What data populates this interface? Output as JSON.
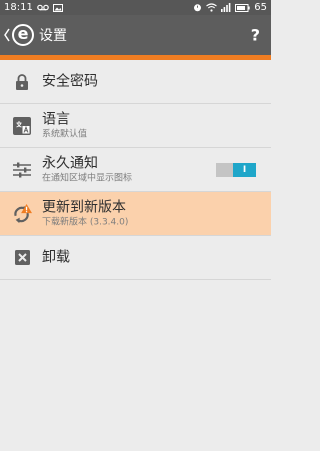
{
  "status_bar": {
    "time": "18:11",
    "battery": "65"
  },
  "app_bar": {
    "title": "设置",
    "help_label": "?",
    "logo_letter": "e"
  },
  "settings": [
    {
      "label": "安全密码",
      "sub": "",
      "icon": "lock-icon"
    },
    {
      "label": "语言",
      "sub": "系统默认值",
      "icon": "language-icon"
    },
    {
      "label": "永久通知",
      "sub": "在通知区域中显示图标",
      "icon": "sliders-icon",
      "toggle": "I",
      "toggle_on": true
    },
    {
      "label": "更新到新版本",
      "sub": "下载新版本 (3.3.4.0)",
      "icon": "update-warning-icon"
    },
    {
      "label": "卸载",
      "sub": "",
      "icon": "uninstall-icon"
    }
  ],
  "colors": {
    "accent": "#f07d22",
    "toggle_on": "#1fa6c9",
    "highlight_row": "#fbd1ac"
  }
}
